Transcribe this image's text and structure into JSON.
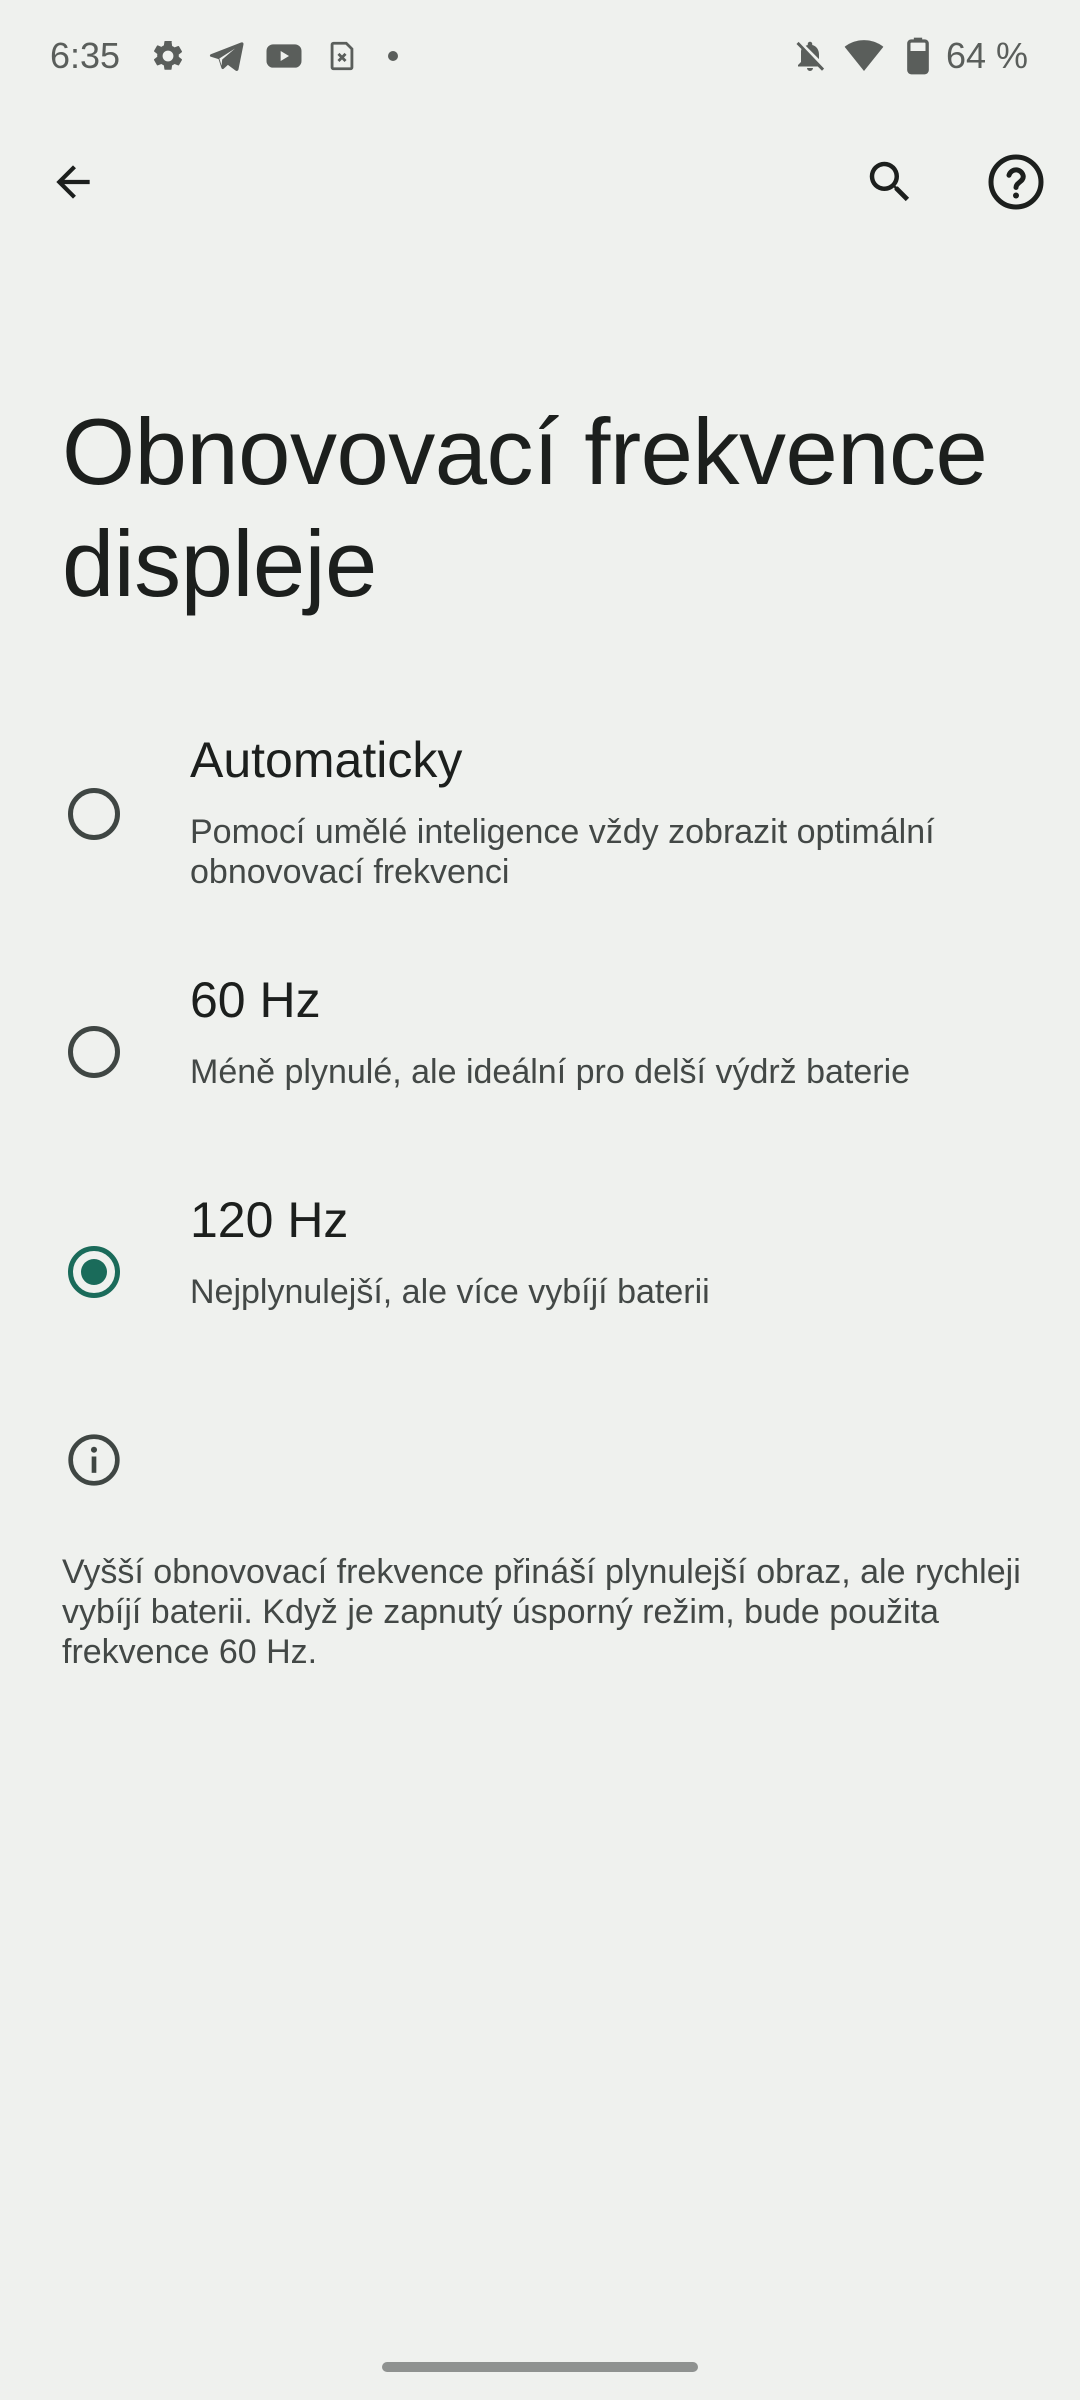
{
  "status_bar": {
    "time": "6:35",
    "left_icons": [
      "settings-icon",
      "telegram-icon",
      "youtube-icon",
      "no-sim-icon"
    ],
    "right_icons": [
      "notifications-off-icon",
      "wifi-icon",
      "battery-icon"
    ],
    "battery": "64 %"
  },
  "app_bar": {
    "back_icon": "arrow-back-icon",
    "search_icon": "search-icon",
    "help_icon": "help-icon"
  },
  "page": {
    "title": "Obnovovací frekvence displeje"
  },
  "options": [
    {
      "title": "Automaticky",
      "summary": "Pomocí umělé inteligence vždy zobrazit optimální obnovovací frekvenci",
      "selected": false
    },
    {
      "title": "60 Hz",
      "summary": "Méně plynulé, ale ideální pro delší výdrž baterie",
      "selected": false
    },
    {
      "title": "120 Hz",
      "summary": "Nejplynulejší, ale více vybíjí baterii",
      "selected": true
    }
  ],
  "footer": {
    "icon": "info-icon",
    "text": "Vyšší obnovovací frekvence přináší plynulejší obraz, ale rychleji vybíjí baterii. Když je zapnutý úsporný režim, bude použita frekvence 60 Hz."
  },
  "colors": {
    "background": "#eff1ee",
    "accent": "#1a6b5a",
    "text_primary": "#1c1f1d",
    "text_secondary": "#434846"
  }
}
